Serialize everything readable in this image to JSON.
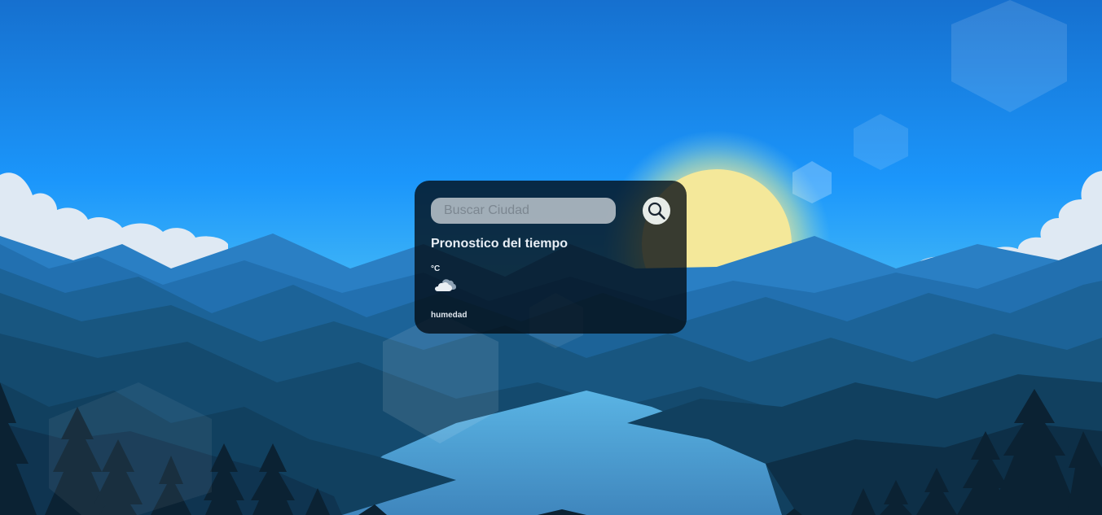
{
  "search": {
    "placeholder": "Buscar Ciudad",
    "value": "",
    "button_icon": "search-icon"
  },
  "forecast": {
    "title": "Pronostico del tiempo",
    "temperature_unit": "°C",
    "weather_icon": "cloud-icon",
    "humidity_label": "humedad"
  },
  "theme": {
    "sky_top": "#1670cf",
    "sky_mid": "#1b96fb",
    "sun": "#f4e89a",
    "card_bg": "#030a12"
  }
}
